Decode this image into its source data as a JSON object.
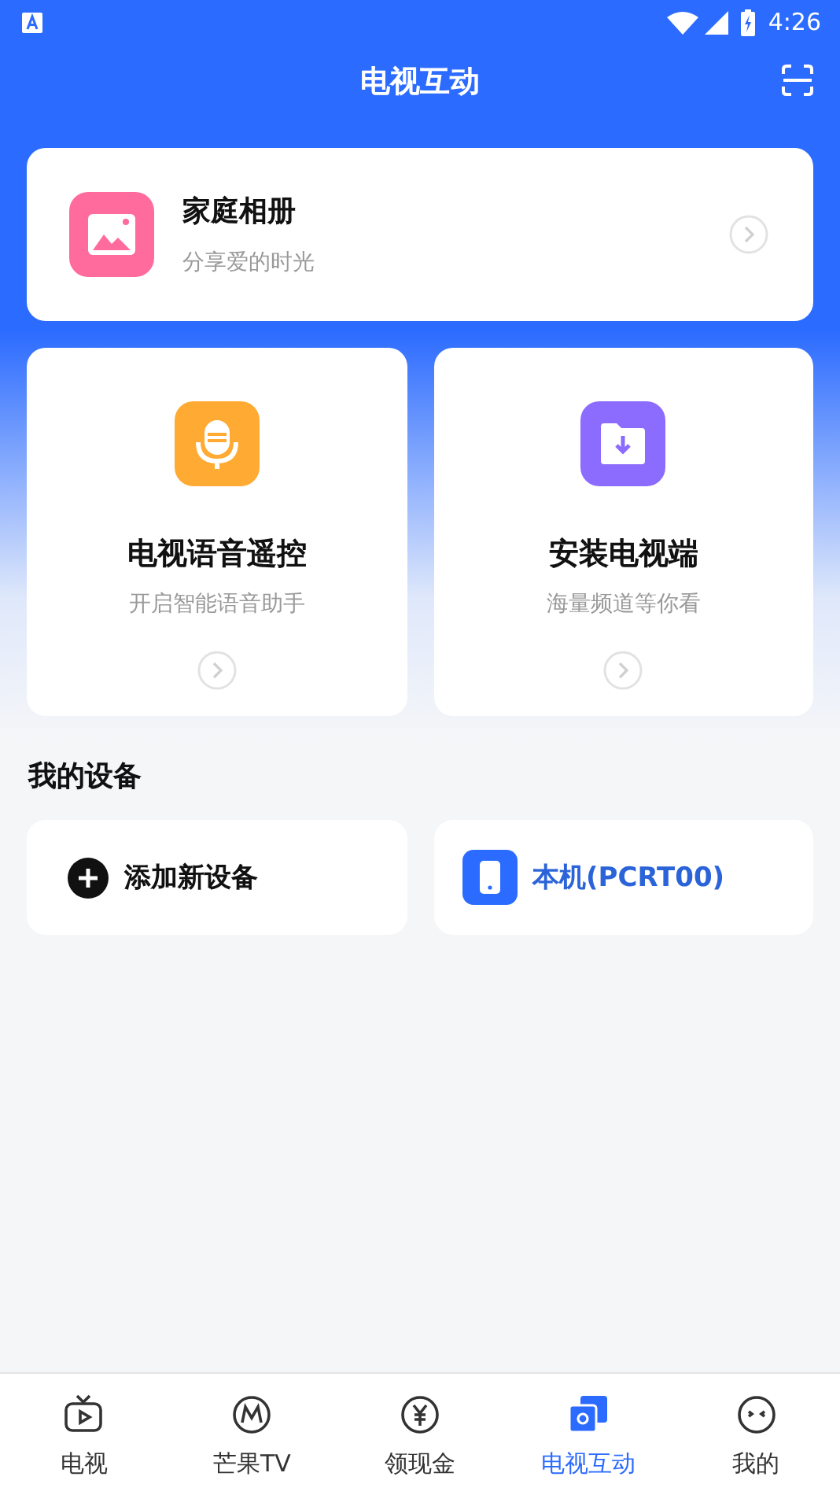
{
  "status_bar": {
    "time": "4:26"
  },
  "header": {
    "title": "电视互动"
  },
  "album_card": {
    "title": "家庭相册",
    "subtitle": "分享爱的时光"
  },
  "feature_cards": [
    {
      "kind": "voice",
      "title": "电视语音遥控",
      "subtitle": "开启智能语音助手"
    },
    {
      "kind": "install",
      "title": "安装电视端",
      "subtitle": "海量频道等你看"
    }
  ],
  "devices_section": {
    "title": "我的设备",
    "devices": [
      {
        "kind": "add",
        "label": "添加新设备"
      },
      {
        "kind": "phone",
        "label": "本机(PCRT00)"
      }
    ]
  },
  "tab_bar": [
    {
      "kind": "tv",
      "label": "电视",
      "selected": false
    },
    {
      "kind": "mango",
      "label": "芒果TV",
      "selected": false
    },
    {
      "kind": "money",
      "label": "领现金",
      "selected": false
    },
    {
      "kind": "interact",
      "label": "电视互动",
      "selected": true
    },
    {
      "kind": "me",
      "label": "我的",
      "selected": false
    }
  ]
}
